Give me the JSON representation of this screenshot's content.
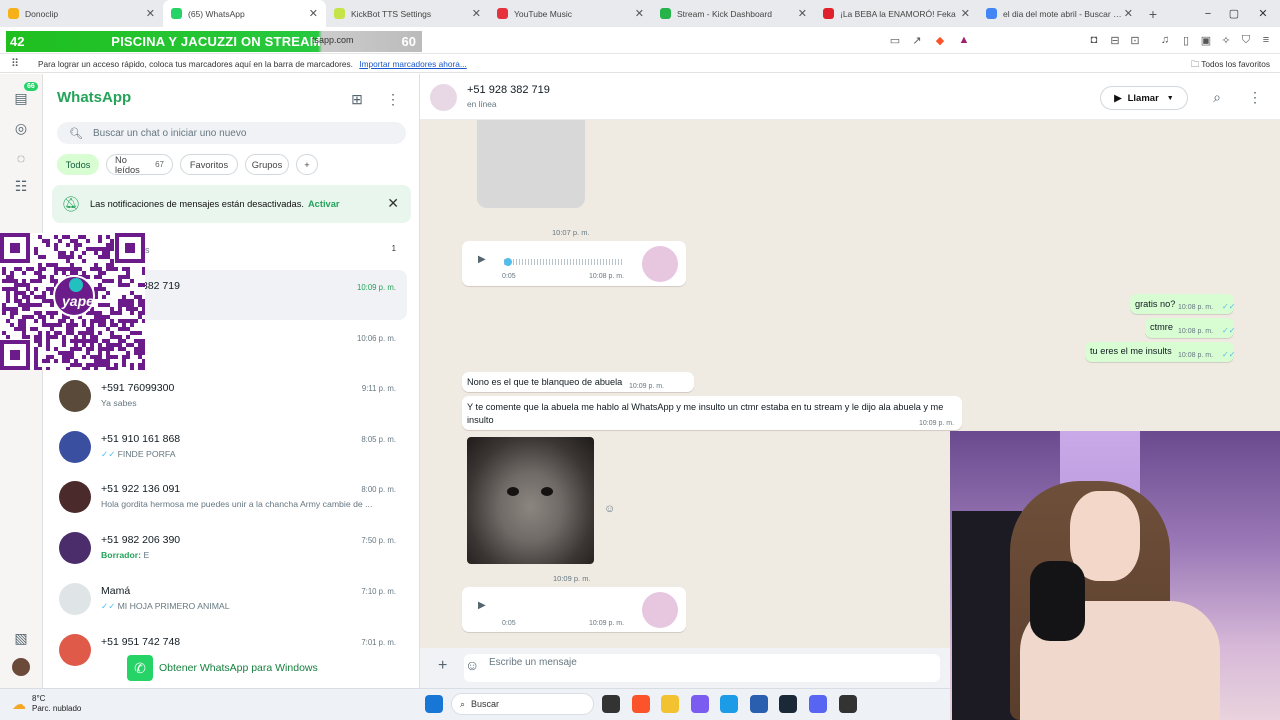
{
  "tabs": [
    {
      "title": "Donoclip",
      "color": "#f6b01a"
    },
    {
      "title": "(65) WhatsApp",
      "color": "#25d366",
      "active": true
    },
    {
      "title": "KickBot TTS Settings",
      "color": "#c6e34a"
    },
    {
      "title": "YouTube Music",
      "color": "#e6323d"
    },
    {
      "title": "Stream - Kick Dashboard",
      "color": "#26b34a"
    },
    {
      "title": "¡La BEBA la ENAMORÓ! Feka",
      "color": "#e0202a"
    },
    {
      "title": "el dia del mote abril - Buscar con Go",
      "color": "#4285f4"
    }
  ],
  "new_tab_glyph": "+",
  "window_controls": {
    "minimize": "−",
    "maximize": "▢",
    "close": "✕"
  },
  "stream_banner": {
    "left": "42",
    "text": "PISCINA Y JACUZZI ON STREAM",
    "right": "60"
  },
  "url_fragment": "tsapp.com",
  "bookmarks": {
    "hint": "Para lograr un acceso rápido, coloca tus marcadores aquí en la barra de marcadores.",
    "import_link": "Importar marcadores ahora...",
    "all": "Todos los favoritos"
  },
  "rail": {
    "badge": "66"
  },
  "whatsapp": {
    "title": "WhatsApp"
  },
  "search": {
    "placeholder": "Buscar un chat o iniciar uno nuevo"
  },
  "filters": [
    {
      "label": "Todos"
    },
    {
      "label": "No leídos",
      "count": "67"
    },
    {
      "label": "Favoritos"
    },
    {
      "label": "Grupos"
    },
    {
      "label": "+"
    }
  ],
  "notification": {
    "text": "Las notificaciones de mensajes están desactivadas.",
    "action": "Activar"
  },
  "partial_rows": {
    "archived_label": "os",
    "archived_count": "1",
    "sel_name": "382 719",
    "sel_time": "10:09 p. m.",
    "row3_time": "10:06 p. m."
  },
  "chats": [
    {
      "name": "+591 76099300",
      "preview": "Ya sabes",
      "time": "9:11 p. m."
    },
    {
      "name": "+51 910 161 868",
      "preview": "FINDE PORFA",
      "time": "8:05 p. m.",
      "tick": true
    },
    {
      "name": "+51 922 136 091",
      "preview": "Hola gordita hermosa me puedes unir a la chancha Army cambie de ...",
      "time": "8:00 p. m."
    },
    {
      "name": "+51 982 206 390",
      "preview": "E",
      "draft": "Borrador:",
      "time": "7:50 p. m."
    },
    {
      "name": "Mamá",
      "preview": "MI HOJA PRIMERO ANIMAL",
      "time": "7:10 p. m.",
      "tick": true
    },
    {
      "name": "+51 951 742 748",
      "preview": "",
      "time": "7:01 p. m."
    }
  ],
  "get_windows": "Obtener WhatsApp para Windows",
  "chat": {
    "name": "+51 928 382 719",
    "status": "en línea",
    "call_label": "Llamar"
  },
  "messages": {
    "ts1": "10:07 p. m.",
    "audio1": {
      "duration": "0:05",
      "time": "10:08 p. m."
    },
    "out": [
      {
        "text": "gratis no?",
        "time": "10:08 p. m."
      },
      {
        "text": "ctmre",
        "time": "10:08 p. m."
      },
      {
        "text": "tu eres el me insults",
        "time": "10:08 p. m."
      }
    ],
    "in1": {
      "text": "Nono es el que te blanqueo de abuela",
      "time": "10:09 p. m."
    },
    "in2": {
      "text": "Y te comente  que la abuela me hablo al WhatsApp y me insulto un ctmr estaba en tu stream y le dijo ala abuela y me insulto",
      "time": "10:09 p. m."
    },
    "ts2": "10:09 p. m.",
    "audio2": {
      "duration": "0:05",
      "time": "10:09 p. m."
    }
  },
  "composer": {
    "placeholder": "Escribe un mensaje"
  },
  "taskbar": {
    "temp": "8°C",
    "cond": "Parc. nublado",
    "search": "Buscar"
  }
}
